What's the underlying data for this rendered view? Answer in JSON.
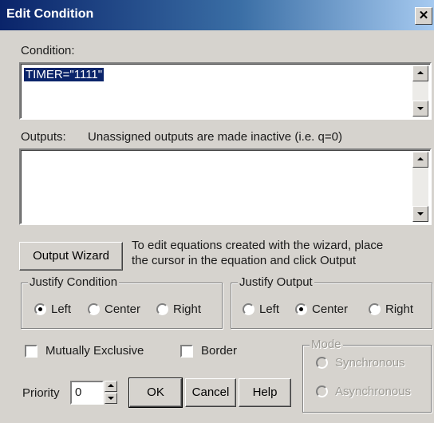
{
  "window": {
    "title": "Edit Condition",
    "close_glyph": "✕"
  },
  "condition": {
    "label": "Condition:",
    "value": "TIMER=\"1111\""
  },
  "outputs": {
    "label": "Outputs:",
    "note": "Unassigned outputs are made inactive (i.e. q=0)",
    "value": ""
  },
  "wizard": {
    "button_label": "Output Wizard",
    "hint_line1": "To edit equations created with the wizard, place",
    "hint_line2": "the cursor in the equation and click Output"
  },
  "justify_condition": {
    "label": "Justify Condition",
    "options": [
      "Left",
      "Center",
      "Right"
    ],
    "selected": "Left"
  },
  "justify_output": {
    "label": "Justify Output",
    "options": [
      "Left",
      "Center",
      "Right"
    ],
    "selected": "Center"
  },
  "checkboxes": {
    "mutually_exclusive": "Mutually Exclusive",
    "border": "Border"
  },
  "mode": {
    "label": "Mode",
    "options": [
      "Synchronous",
      "Asynchronous"
    ]
  },
  "priority": {
    "label": "Priority",
    "value": "0"
  },
  "buttons": {
    "ok": "OK",
    "cancel": "Cancel",
    "help": "Help"
  }
}
